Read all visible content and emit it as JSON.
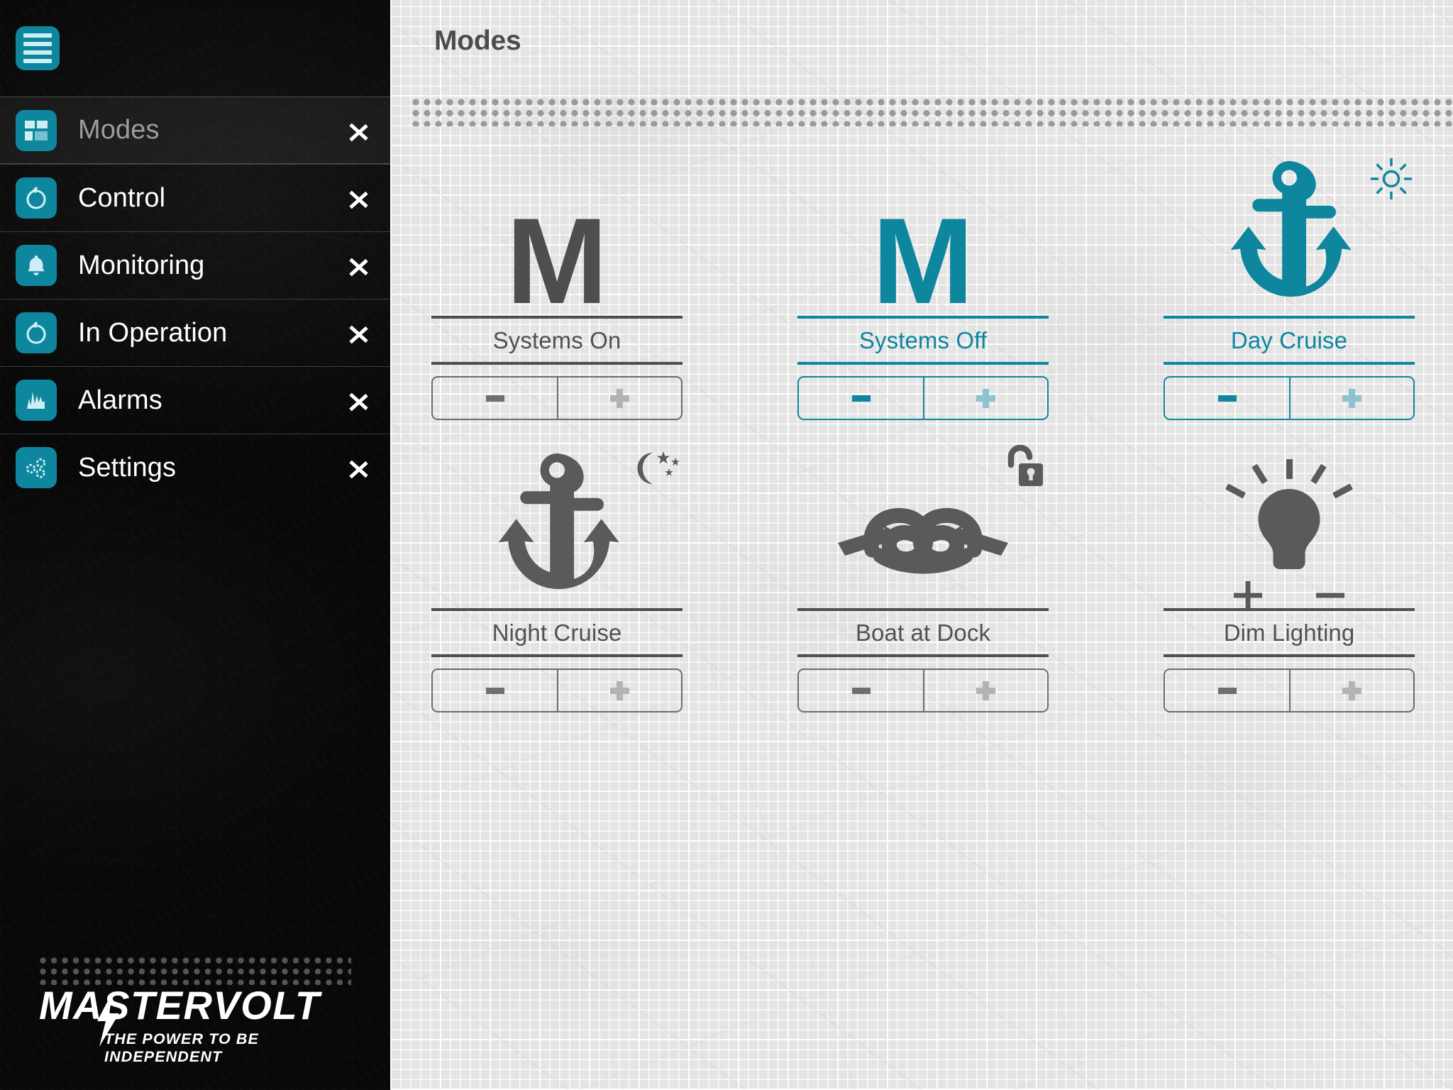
{
  "colors": {
    "accent": "#0d869e",
    "dark_gray": "#4e4e4e",
    "sidebar_bg": "#080808",
    "paper_bg": "#e4e4e4",
    "plus_muted": "#b3b3b3"
  },
  "sidebar": {
    "menu_button": {
      "icon": "hamburger-menu-icon"
    },
    "items": [
      {
        "label": "Modes",
        "icon": "grid-tiles-icon",
        "chevron": "chevron-right-icon",
        "selected": true
      },
      {
        "label": "Control",
        "icon": "power-knob-icon",
        "chevron": "chevron-right-icon",
        "selected": false
      },
      {
        "label": "Monitoring",
        "icon": "bell-icon",
        "chevron": "chevron-right-icon",
        "selected": false
      },
      {
        "label": "In Operation",
        "icon": "power-knob-icon",
        "chevron": "chevron-right-icon",
        "selected": false
      },
      {
        "label": "Alarms",
        "icon": "waveform-icon",
        "chevron": "chevron-right-icon",
        "selected": false
      },
      {
        "label": "Settings",
        "icon": "gears-icon",
        "chevron": "chevron-right-icon",
        "selected": false
      }
    ],
    "logo": {
      "wordmark": "MASTERVOLT",
      "tagline": "THE POWER TO BE INDEPENDENT",
      "bolt_icon": "lightning-bolt-icon"
    }
  },
  "header": {
    "title": "Modes",
    "divider": "dotted-divider"
  },
  "modes": [
    {
      "id": "systems-on",
      "label": "Systems On",
      "art": "letter-m",
      "art_text": "M",
      "badge": null,
      "accent": false,
      "minus_label": "−",
      "plus_label": "+"
    },
    {
      "id": "systems-off",
      "label": "Systems Off",
      "art": "letter-m",
      "art_text": "M",
      "badge": null,
      "accent": true,
      "minus_label": "−",
      "plus_label": "+"
    },
    {
      "id": "day-cruise",
      "label": "Day Cruise",
      "art": "anchor-icon",
      "art_text": "",
      "badge": "sun-icon",
      "accent": true,
      "minus_label": "−",
      "plus_label": "+"
    },
    {
      "id": "night-cruise",
      "label": "Night Cruise",
      "art": "anchor-icon",
      "art_text": "",
      "badge": "moon-stars-icon",
      "accent": false,
      "minus_label": "−",
      "plus_label": "+"
    },
    {
      "id": "boat-at-dock",
      "label": "Boat at Dock",
      "art": "rope-knot-icon",
      "art_text": "",
      "badge": "unlocked-padlock-icon",
      "accent": false,
      "minus_label": "−",
      "plus_label": "+"
    },
    {
      "id": "dim-lighting",
      "label": "Dim Lighting",
      "art": "light-bulb-icon",
      "art_text": "",
      "badge": null,
      "dim_marks": [
        "+",
        "−"
      ],
      "accent": false,
      "minus_label": "−",
      "plus_label": "+"
    }
  ]
}
